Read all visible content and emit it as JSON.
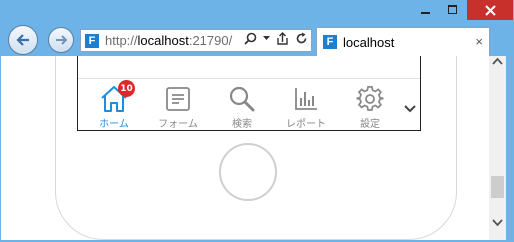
{
  "browser": {
    "address": {
      "prefix": "http://",
      "host": "localhost",
      "suffix": ":21790/"
    },
    "tab": {
      "title": "localhost",
      "close": "×"
    },
    "favicon_letter": "F"
  },
  "app": {
    "tabbar": [
      {
        "label": "ホーム",
        "icon": "home-icon",
        "active": true
      },
      {
        "label": "フォーム",
        "icon": "form-icon",
        "active": false
      },
      {
        "label": "検索",
        "icon": "search-icon",
        "active": false
      },
      {
        "label": "レポート",
        "icon": "report-icon",
        "active": false
      },
      {
        "label": "設定",
        "icon": "gear-icon",
        "active": false
      }
    ],
    "badge": "10",
    "accent_color": "#1a8fe0",
    "badge_color": "#e0262b"
  }
}
